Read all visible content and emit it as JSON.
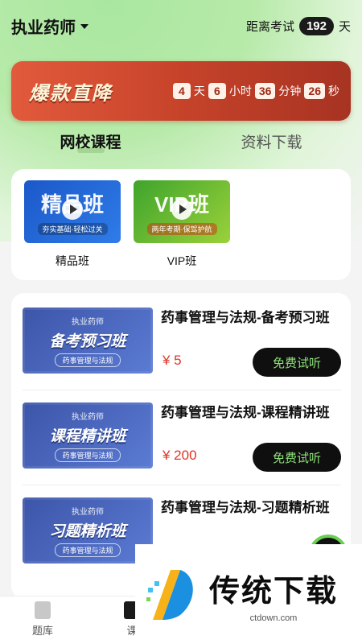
{
  "header": {
    "title": "执业药师",
    "countdown_label": "距离考试",
    "days_left": "192",
    "days_unit": "天"
  },
  "promo": {
    "text": "爆款直降",
    "timer": [
      {
        "value": "4",
        "unit": "天"
      },
      {
        "value": "6",
        "unit": "小时"
      },
      {
        "value": "36",
        "unit": "分钟"
      },
      {
        "value": "26",
        "unit": "秒"
      }
    ]
  },
  "tabs": [
    {
      "label": "网校课程",
      "active": true
    },
    {
      "label": "资料下载",
      "active": false
    }
  ],
  "classes": [
    {
      "thumb_text": "精品班",
      "thumb_sub": "夯实基础·轻松过关",
      "label": "精品班"
    },
    {
      "thumb_text": "VIP班",
      "thumb_sub": "两年考期·保驾护航",
      "label": "VIP班"
    }
  ],
  "courses": [
    {
      "thumb_top": "执业药师",
      "thumb_name": "备考预习班",
      "thumb_tag": "药事管理与法规",
      "title": "药事管理与法规-备考预习班",
      "price": "¥ 5",
      "button": "免费试听"
    },
    {
      "thumb_top": "执业药师",
      "thumb_name": "课程精讲班",
      "thumb_tag": "药事管理与法规",
      "title": "药事管理与法规-课程精讲班",
      "price": "¥ 200",
      "button": "免费试听"
    },
    {
      "thumb_top": "执业药师",
      "thumb_name": "习题精析班",
      "thumb_tag": "药事管理与法规",
      "title": "药事管理与法规-习题精析班",
      "price": "",
      "button": ""
    }
  ],
  "bottom_nav": [
    {
      "label": "题库",
      "icon": "question-bank-icon"
    },
    {
      "label": "课",
      "icon": "course-icon"
    }
  ],
  "watermark": {
    "brand": "传统下载",
    "url": "ctdown.com"
  },
  "colors": {
    "accent_green": "#8ee07a",
    "price_red": "#e03324",
    "promo_red": "#c6432a"
  }
}
